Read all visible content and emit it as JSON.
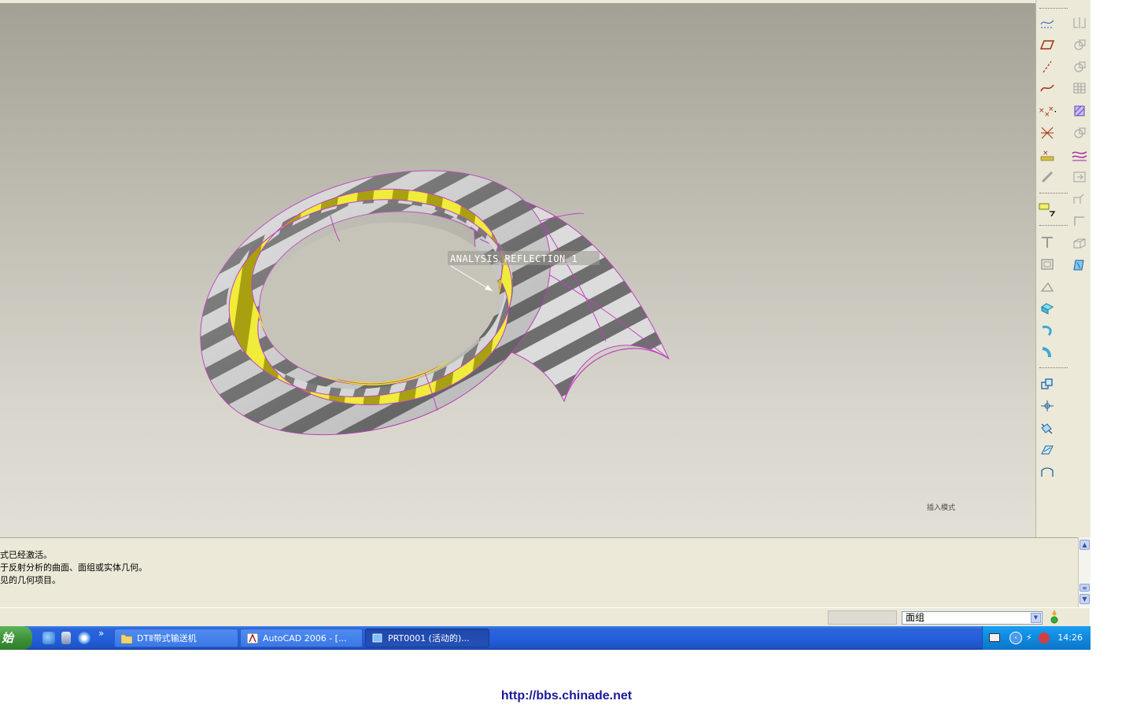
{
  "viewport": {
    "annotation_label": "ANALYSIS_REFLECTION_1",
    "mode_label": "插入模式"
  },
  "right_toolbar": {
    "left_column": [
      "sketch-curve-icon",
      "datum-plane-icon",
      "datum-axis-icon",
      "datum-curve-icon",
      "datum-point-icon",
      "csys-icon",
      "analysis-feature-icon",
      "link-icon",
      "note-icon",
      "shell-icon",
      "hole-icon",
      "draft-icon",
      "extrude-icon",
      "revolve-icon",
      "sweep-icon",
      "copy-icon",
      "pattern-icon",
      "merge-icon",
      "surface-trim-icon",
      "boundary-blend-icon"
    ],
    "right_column": [
      "mirror-icon",
      "copy-feature-icon",
      "move-icon",
      "grid-icon",
      "fill-icon",
      "offset-icon",
      "style-icon",
      "insert-icon",
      "round-icon",
      "chamfer-icon",
      "rib-icon",
      "blend-icon"
    ]
  },
  "messages": [
    "式已经激活。",
    "于反射分析的曲面、面组或实体几何。",
    "见的几何项目。"
  ],
  "status_bar": {
    "filter_value": "面组"
  },
  "taskbar": {
    "start_label": "始",
    "quick_launch": [
      "ie-icon",
      "desktop-icon",
      "media-icon"
    ],
    "overflow": "»",
    "tasks": [
      {
        "label": "DTⅡ带式输送机",
        "icon": "folder-icon",
        "active": false
      },
      {
        "label": "AutoCAD 2006 - [...",
        "icon": "autocad-icon",
        "active": false
      },
      {
        "label": "PRT0001 (活动的)...",
        "icon": "window-icon",
        "active": true
      }
    ],
    "clock": "14:26"
  },
  "watermark": "http://bbs.chinade.net",
  "colors": {
    "accent_yellow": "#e8e020",
    "edge_magenta": "#c040c0",
    "taskbar_blue": "#245fdc"
  }
}
